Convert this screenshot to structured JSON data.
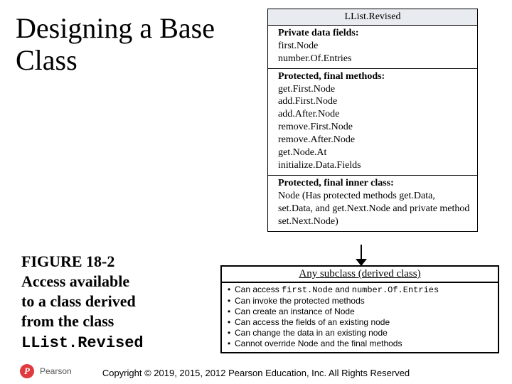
{
  "title": "Designing a Base Class",
  "caption": {
    "line1": "FIGURE 18-2",
    "line2": "Access available",
    "line3": "to a class derived",
    "line4": "from the class",
    "classname": "LList.Revised"
  },
  "uml": {
    "className": "LList.Revised",
    "privateHeader": "Private data fields:",
    "privateFields": [
      "first.Node",
      "number.Of.Entries"
    ],
    "protectedHeader": "Protected, final methods:",
    "protectedMethods": [
      "get.First.Node",
      "add.First.Node",
      "add.After.Node",
      "remove.First.Node",
      "remove.After.Node",
      "get.Node.At",
      "initialize.Data.Fields"
    ],
    "innerHeader": "Protected, final inner class:",
    "innerText": "Node (Has protected methods get.Data, set.Data, and get.Next.Node and private method set.Next.Node)"
  },
  "subclass": {
    "title": "Any subclass (derived class)",
    "items": [
      {
        "pre": "Can access ",
        "code": "first.Node",
        "mid": " and ",
        "code2": "number.Of.Entries",
        "post": ""
      },
      {
        "pre": "Can invoke the protected methods",
        "code": "",
        "mid": "",
        "code2": "",
        "post": ""
      },
      {
        "pre": "Can create an instance of Node",
        "code": "",
        "mid": "",
        "code2": "",
        "post": ""
      },
      {
        "pre": "Can access the fields of an existing node",
        "code": "",
        "mid": "",
        "code2": "",
        "post": ""
      },
      {
        "pre": "Can change the data in an existing node",
        "code": "",
        "mid": "",
        "code2": "",
        "post": ""
      },
      {
        "pre": "Cannot override Node and the final methods",
        "code": "",
        "mid": "",
        "code2": "",
        "post": ""
      }
    ]
  },
  "logo": {
    "glyph": "P",
    "brand": "Pearson"
  },
  "copyright": "Copyright © 2019, 2015, 2012 Pearson Education, Inc. All Rights Reserved"
}
